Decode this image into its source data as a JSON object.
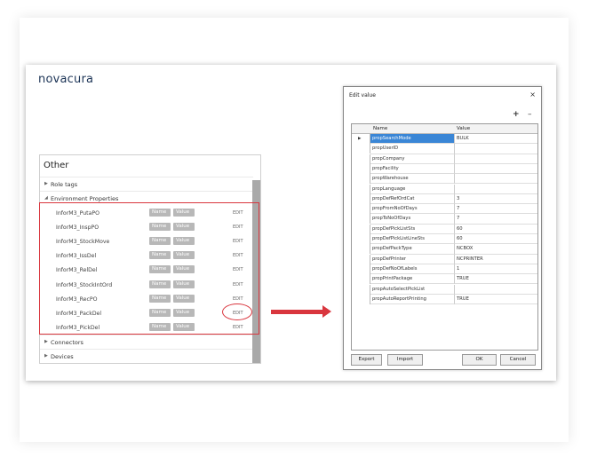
{
  "logo": "novacura",
  "panel": {
    "title": "Other",
    "rows": [
      {
        "label": "Role tags",
        "arrow": "▶"
      },
      {
        "label": "Environment Properties",
        "arrow": "◢"
      },
      {
        "label": "Connectors",
        "arrow": "▶"
      },
      {
        "label": "Devices",
        "arrow": "▶"
      }
    ],
    "env_items": [
      {
        "name": "InforM3_PutaPO",
        "name_chip": "Name",
        "value_chip": "Value",
        "edit": "EDIT"
      },
      {
        "name": "InforM3_InspPO",
        "name_chip": "Name",
        "value_chip": "Value",
        "edit": "EDIT"
      },
      {
        "name": "InforM3_StockMove",
        "name_chip": "Name",
        "value_chip": "Value",
        "edit": "EDIT"
      },
      {
        "name": "InforM3_IssDel",
        "name_chip": "Name",
        "value_chip": "Value",
        "edit": "EDIT"
      },
      {
        "name": "InforM3_RelDel",
        "name_chip": "Name",
        "value_chip": "Value",
        "edit": "EDIT"
      },
      {
        "name": "InforM3_StockIntOrd",
        "name_chip": "Name",
        "value_chip": "Value",
        "edit": "EDIT"
      },
      {
        "name": "InforM3_RecPO",
        "name_chip": "Name",
        "value_chip": "Value",
        "edit": "EDIT"
      },
      {
        "name": "InforM3_PackDel",
        "name_chip": "Name",
        "value_chip": "Value",
        "edit": "EDIT"
      },
      {
        "name": "InforM3_PickDel",
        "name_chip": "Name",
        "value_chip": "Value",
        "edit": "EDIT"
      }
    ]
  },
  "dialog": {
    "title": "Edit value",
    "close": "×",
    "plus": "+",
    "minus": "–",
    "columns": {
      "name": "Name",
      "value": "Value"
    },
    "rows": [
      {
        "name": "propSearchMode",
        "value": "BULK"
      },
      {
        "name": "propUserID",
        "value": ""
      },
      {
        "name": "propCompany",
        "value": ""
      },
      {
        "name": "propFacility",
        "value": ""
      },
      {
        "name": "propWarehouse",
        "value": ""
      },
      {
        "name": "propLanguage",
        "value": ""
      },
      {
        "name": "propDefRefOrdCat",
        "value": "3"
      },
      {
        "name": "propFromNoOfDays",
        "value": "7"
      },
      {
        "name": "propToNoOfDays",
        "value": "7"
      },
      {
        "name": "propDefPickListSts",
        "value": "60"
      },
      {
        "name": "propDefPickListLineSts",
        "value": "60"
      },
      {
        "name": "propDefPackType",
        "value": "NCBOX"
      },
      {
        "name": "propDefPrinter",
        "value": "NCPRINTER"
      },
      {
        "name": "propDefNoOfLabels",
        "value": "1"
      },
      {
        "name": "propPrintPackage",
        "value": "TRUE"
      },
      {
        "name": "propAutoSelectPickList",
        "value": ""
      },
      {
        "name": "propAutoReportPrinting",
        "value": "TRUE"
      }
    ],
    "pointer": "▶",
    "buttons": {
      "export": "Export",
      "import": "Import",
      "ok": "OK",
      "cancel": "Cancel"
    }
  },
  "colors": {
    "highlight": "#d9363e",
    "selection": "#3a86d6"
  }
}
